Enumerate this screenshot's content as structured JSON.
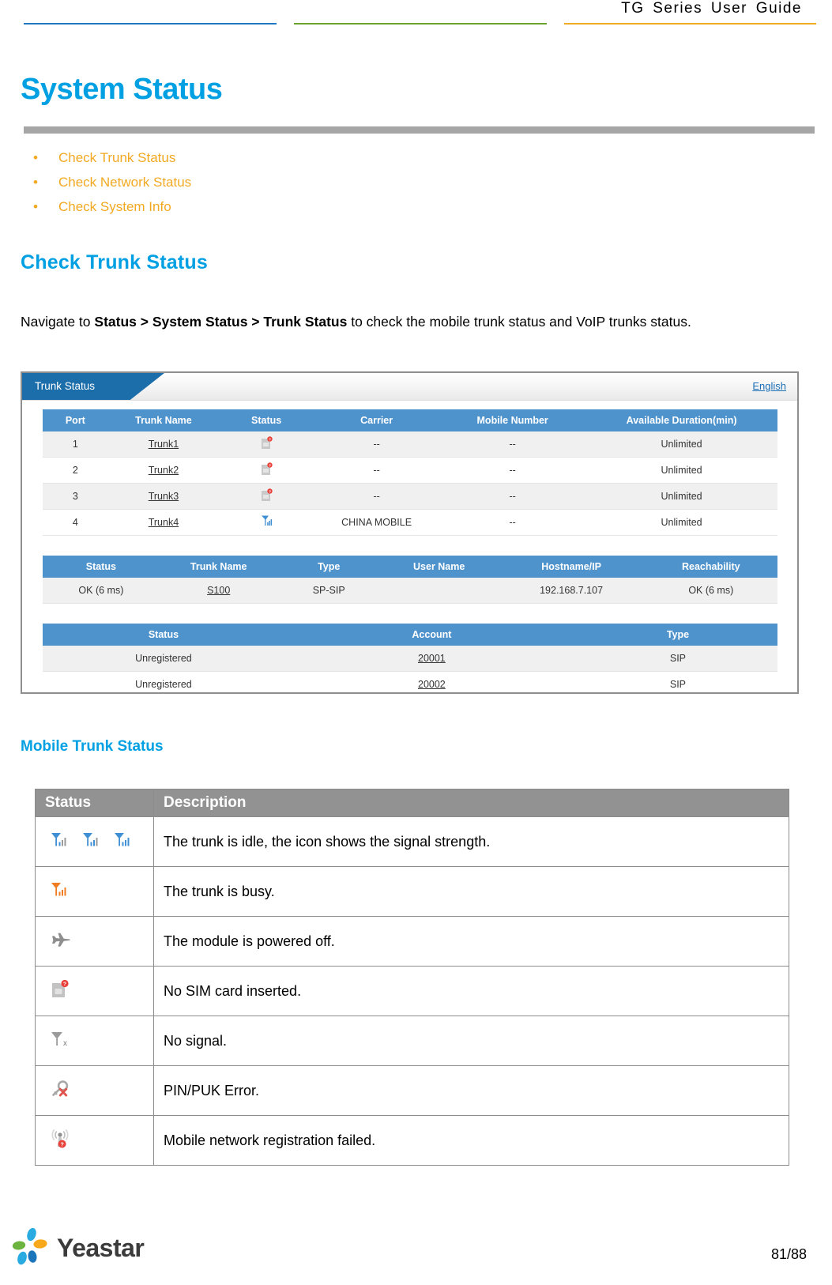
{
  "header": {
    "title": "TG Series User Guide",
    "rule_colors": {
      "blue": "#1f78c1",
      "green": "#6aa22e",
      "yellow": "#f0ab20"
    }
  },
  "doc": {
    "title": "System Status",
    "accent_color": "#00a0e3",
    "bullet_color": "#f2a922"
  },
  "bullets": [
    {
      "label": "Check Trunk Status"
    },
    {
      "label": "Check Network Status"
    },
    {
      "label": "Check System Info"
    }
  ],
  "sections": {
    "check_trunk_status": "Check Trunk Status",
    "mobile_trunk_status": "Mobile Trunk Status"
  },
  "paragraph": {
    "before": "Navigate to ",
    "bold": "Status > System Status > Trunk Status",
    "after": " to check the mobile trunk status and VoIP trunks status."
  },
  "screenshot": {
    "tab_label": "Trunk Status",
    "language_link": "English",
    "mobile_table": {
      "headers": [
        "Port",
        "Trunk Name",
        "Status",
        "Carrier",
        "Mobile Number",
        "Available Duration(min)"
      ],
      "rows": [
        {
          "port": "1",
          "trunk_name": "Trunk1",
          "status_icon": "sim-card-missing-icon",
          "carrier": "--",
          "mobile_number": "--",
          "duration": "Unlimited"
        },
        {
          "port": "2",
          "trunk_name": "Trunk2",
          "status_icon": "sim-card-missing-icon",
          "carrier": "--",
          "mobile_number": "--",
          "duration": "Unlimited"
        },
        {
          "port": "3",
          "trunk_name": "Trunk3",
          "status_icon": "sim-card-missing-icon",
          "carrier": "--",
          "mobile_number": "--",
          "duration": "Unlimited"
        },
        {
          "port": "4",
          "trunk_name": "Trunk4",
          "status_icon": "signal-bars-icon",
          "carrier": "CHINA MOBILE",
          "mobile_number": "--",
          "duration": "Unlimited"
        }
      ]
    },
    "voip_table": {
      "headers": [
        "Status",
        "Trunk Name",
        "Type",
        "User Name",
        "Hostname/IP",
        "Reachability"
      ],
      "rows": [
        {
          "status": "OK (6 ms)",
          "trunk_name": "S100",
          "type": "SP-SIP",
          "user_name": "",
          "hostname_ip": "192.168.7.107",
          "reachability": "OK (6 ms)"
        }
      ]
    },
    "account_table": {
      "headers": [
        "Status",
        "Account",
        "Type"
      ],
      "rows": [
        {
          "status": "Unregistered",
          "account": "20001",
          "type": "SIP"
        },
        {
          "status": "Unregistered",
          "account": "20002",
          "type": "SIP"
        }
      ]
    }
  },
  "status_table": {
    "headers": [
      "Status",
      "Description"
    ],
    "rows": [
      {
        "icon": "signal-bars-idle-icon",
        "description": "The trunk is idle, the icon shows the signal strength."
      },
      {
        "icon": "signal-bars-busy-icon",
        "description": "The trunk is busy."
      },
      {
        "icon": "airplane-icon",
        "description": "The module is powered off."
      },
      {
        "icon": "sim-card-missing-icon",
        "description": "No SIM card inserted."
      },
      {
        "icon": "no-signal-icon",
        "description": "No signal."
      },
      {
        "icon": "key-error-icon",
        "description": "PIN/PUK Error."
      },
      {
        "icon": "network-registration-failed-icon",
        "description": "Mobile network registration failed."
      }
    ]
  },
  "footer": {
    "brand": "Yeastar",
    "page": "81/88",
    "logo_colors": {
      "blue": "#29abe2",
      "orange": "#f7a81b",
      "green": "#6cb33f",
      "dark_blue": "#1b75bb"
    }
  }
}
